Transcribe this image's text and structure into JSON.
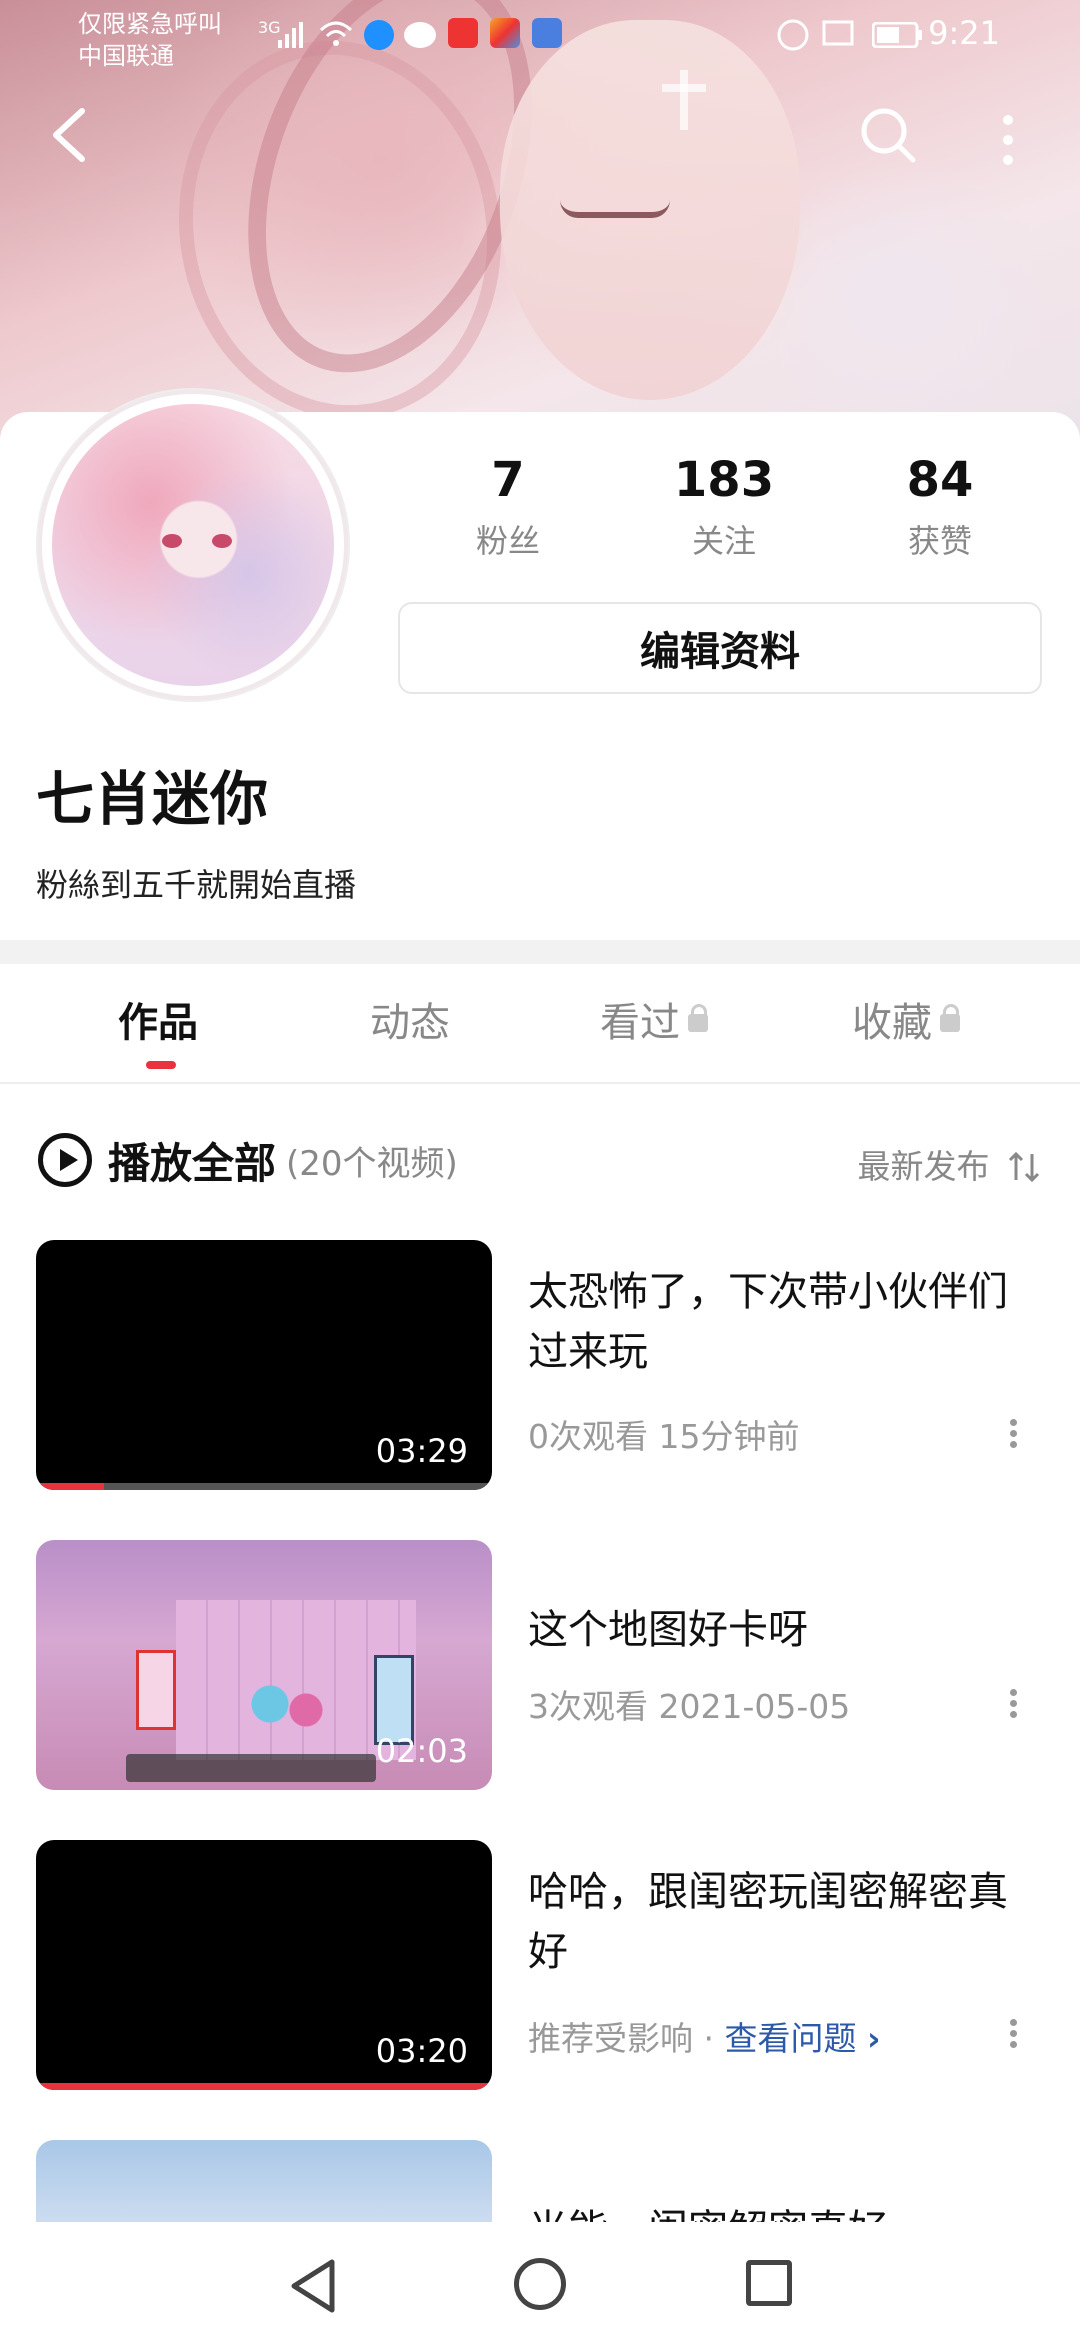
{
  "status_bar": {
    "notification_line1": "仅限紧急呼叫",
    "notification_line2": "中国联通",
    "network": "3G",
    "time": "9:21"
  },
  "header": {
    "back_icon": "chevron-left-icon",
    "search_icon": "search-icon",
    "more_icon": "more-vertical-icon"
  },
  "profile": {
    "stats": [
      {
        "value": "7",
        "label": "粉丝"
      },
      {
        "value": "183",
        "label": "关注"
      },
      {
        "value": "84",
        "label": "获赞"
      }
    ],
    "edit_button_label": "编辑资料",
    "username": "七肖迷你",
    "bio": "粉絲到五千就開始直播"
  },
  "tabs": [
    {
      "label": "作品",
      "active": true,
      "locked": false
    },
    {
      "label": "动态",
      "active": false,
      "locked": false
    },
    {
      "label": "看过",
      "active": false,
      "locked": true
    },
    {
      "label": "收藏",
      "active": false,
      "locked": true
    }
  ],
  "play_all": {
    "label": "播放全部",
    "count": "(20个视频)",
    "sort_label": "最新发布"
  },
  "videos": [
    {
      "title": "太恐怖了，下次带小伙伴们过来玩",
      "duration": "03:29",
      "meta": "0次观看  15分钟前",
      "progress": 0.15
    },
    {
      "title": "这个地图好卡呀",
      "duration": "02:03",
      "meta": "3次观看  2021-05-05",
      "progress": 0
    },
    {
      "title": "哈哈，跟闺密玩闺密解密真好",
      "duration": "03:20",
      "meta": "推荐受影响 · ",
      "meta_link": "查看问题",
      "progress": 1.0
    },
    {
      "title": "光能，闺密解密真好",
      "duration": "",
      "meta": "",
      "progress": 0
    }
  ],
  "colors": {
    "accent": "#e8333e",
    "link": "#2d5aa8",
    "muted": "#888888"
  }
}
